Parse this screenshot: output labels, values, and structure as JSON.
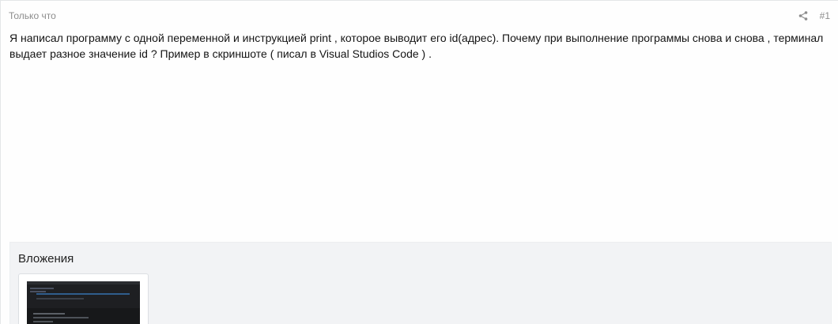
{
  "post": {
    "time": "Только что",
    "number": "#1",
    "text": "Я написал программу с одной переменной и инструкцией print , которое выводит его id(адрес). Почему при выполнение программы снова и снова , терминал выдает разное значение id ? Пример в скриншоте ( писал в Visual Studios Code ) ."
  },
  "attachments": {
    "title": "Вложения"
  },
  "icons": {
    "share": "share-icon"
  },
  "colors": {
    "muted_text": "#8c8c8c",
    "attachments_bg": "#f2f3f5"
  }
}
